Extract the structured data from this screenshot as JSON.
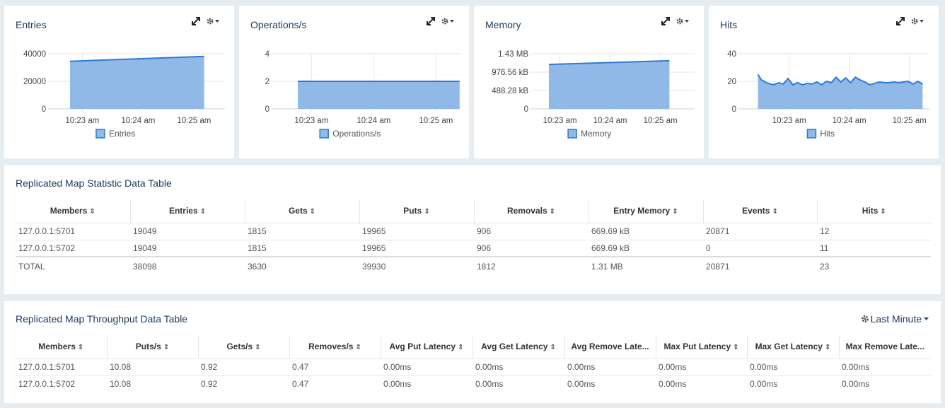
{
  "colors": {
    "fill": "#90b9e8",
    "line": "#2d7bd1",
    "title": "#1f3a5a",
    "grid": "#e6e6e6"
  },
  "charts": [
    {
      "title": "Entries",
      "legend": "Entries",
      "chart_data": {
        "type": "area",
        "title": "Entries",
        "x_ticks": [
          "10:23 am",
          "10:24 am",
          "10:25 am"
        ],
        "y_ticks": [
          "40000",
          "20000",
          "0"
        ],
        "ylim": [
          0,
          40000
        ],
        "series": [
          {
            "name": "Entries",
            "x": [
              0.0,
              2.4
            ],
            "values": [
              34500,
              38098
            ]
          }
        ]
      }
    },
    {
      "title": "Operations/s",
      "legend": "Operations/s",
      "chart_data": {
        "type": "area",
        "title": "Operations/s",
        "x_ticks": [
          "10:23 am",
          "10:24 am",
          "10:25 am"
        ],
        "y_ticks": [
          "4",
          "2",
          "0"
        ],
        "ylim": [
          0,
          4
        ],
        "series": [
          {
            "name": "Operations/s",
            "x": [
              0.0,
              2.6
            ],
            "values": [
              2,
              2
            ]
          }
        ]
      }
    },
    {
      "title": "Memory",
      "legend": "Memory",
      "chart_data": {
        "type": "area",
        "title": "Memory",
        "x_ticks": [
          "10:23 am",
          "10:24 am",
          "10:25 am"
        ],
        "y_ticks": [
          "1.43 MB",
          "976.56 kB",
          "488.28 kB",
          "0"
        ],
        "ylim": [
          0,
          1.5
        ],
        "series": [
          {
            "name": "Memory",
            "x": [
              0.0,
              2.4
            ],
            "values": [
              1.21,
              1.31
            ]
          }
        ]
      }
    },
    {
      "title": "Hits",
      "legend": "Hits",
      "chart_data": {
        "type": "area",
        "title": "Hits",
        "x_ticks": [
          "10:23 am",
          "10:24 am",
          "10:25 am"
        ],
        "y_ticks": [
          "40",
          "20",
          "0"
        ],
        "ylim": [
          0,
          40
        ],
        "series": [
          {
            "name": "Hits",
            "x": [
              -0.3,
              -0.24,
              -0.16,
              -0.05,
              0.05,
              0.12,
              0.2,
              0.28,
              0.36,
              0.44,
              0.52,
              0.6,
              0.68,
              0.76,
              0.84,
              0.92,
              1.0,
              1.08,
              1.16,
              1.24,
              1.32,
              1.4,
              1.48,
              1.56,
              1.64,
              1.72,
              1.8,
              1.88,
              1.96,
              2.04,
              2.12,
              2.2,
              2.28,
              2.36,
              2.44
            ],
            "values": [
              25,
              21,
              19,
              17.5,
              19,
              18,
              22,
              17.5,
              19,
              17.5,
              18.5,
              18,
              19.5,
              17.5,
              20,
              19,
              23,
              19.5,
              22.5,
              19,
              23,
              21,
              19.5,
              17.5,
              18.5,
              19.5,
              19,
              19,
              19.5,
              19,
              19.5,
              20,
              18,
              20,
              18
            ]
          }
        ]
      }
    }
  ],
  "stats_table": {
    "title": "Replicated Map Statistic Data Table",
    "sort_glyph": "⇕",
    "columns": [
      "Members",
      "Entries",
      "Gets",
      "Puts",
      "Removals",
      "Entry Memory",
      "Events",
      "Hits"
    ],
    "rows": [
      [
        "127.0.0.1:5701",
        "19049",
        "1815",
        "19965",
        "906",
        "669.69 kB",
        "20871",
        "12"
      ],
      [
        "127.0.0.1:5702",
        "19049",
        "1815",
        "19965",
        "906",
        "669.69 kB",
        "0",
        "11"
      ],
      [
        "TOTAL",
        "38098",
        "3630",
        "39930",
        "1812",
        "1.31 MB",
        "20871",
        "23"
      ]
    ]
  },
  "throughput_table": {
    "title": "Replicated Map Throughput Data Table",
    "time_range_label": "Last Minute",
    "columns": [
      "Members",
      "Puts/s",
      "Gets/s",
      "Removes/s",
      "Avg Put Latency",
      "Avg Get Latency",
      "Avg Remove Late...",
      "Max Put Latency",
      "Max Get Latency",
      "Max Remove Late..."
    ],
    "rows": [
      [
        "127.0.0.1:5701",
        "10.08",
        "0.92",
        "0.47",
        "0.00ms",
        "0.00ms",
        "0.00ms",
        "0.00ms",
        "0.00ms",
        "0.00ms"
      ],
      [
        "127.0.0.1:5702",
        "10.08",
        "0.92",
        "0.47",
        "0.00ms",
        "0.00ms",
        "0.00ms",
        "0.00ms",
        "0.00ms",
        "0.00ms"
      ]
    ]
  }
}
